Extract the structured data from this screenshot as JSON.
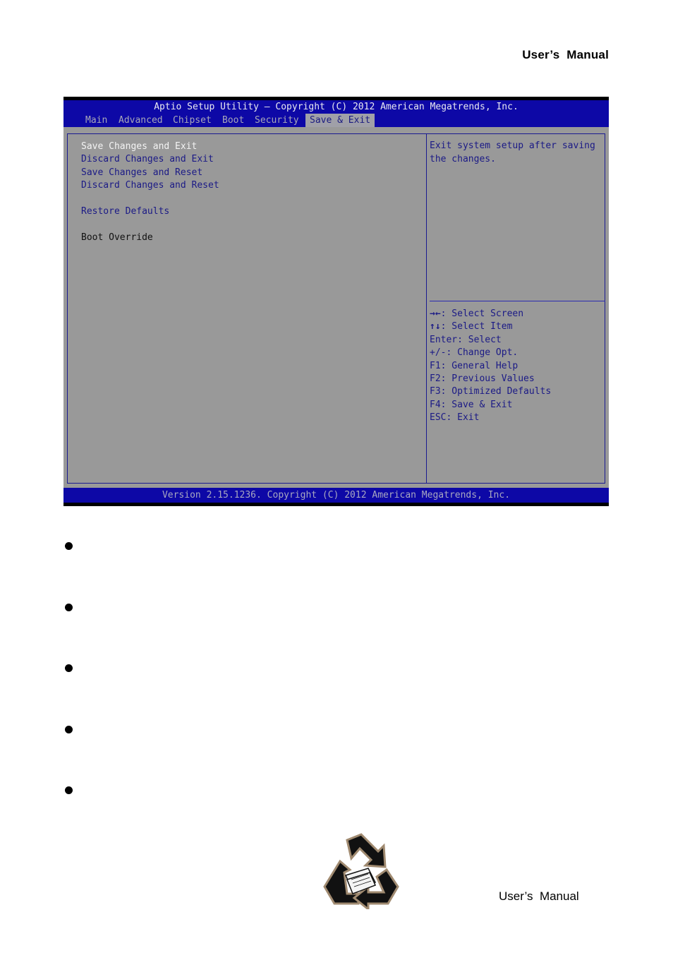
{
  "page": {
    "header_title": "User’s  Manual",
    "footer_title": "User’s  Manual",
    "bullet_count": 5,
    "logo_icon": "recycle-icon"
  },
  "bios": {
    "title": "Aptio Setup Utility – Copyright (C) 2012 American Megatrends, Inc.",
    "tabs": [
      {
        "label": "Main",
        "active": false
      },
      {
        "label": "Advanced",
        "active": false
      },
      {
        "label": "Chipset",
        "active": false
      },
      {
        "label": "Boot",
        "active": false
      },
      {
        "label": "Security",
        "active": false
      },
      {
        "label": "Save & Exit",
        "active": true
      }
    ],
    "menu": [
      {
        "label": "Save Changes and Exit",
        "state": "selected"
      },
      {
        "label": "Discard Changes and Exit",
        "state": "normal"
      },
      {
        "label": "Save Changes and Reset",
        "state": "normal"
      },
      {
        "label": "Discard Changes and Reset",
        "state": "normal"
      },
      {
        "label": "Restore Defaults",
        "state": "normal"
      },
      {
        "label": "Boot Override",
        "state": "static"
      }
    ],
    "help_text": "Exit system setup after saving\nthe changes.",
    "keys": [
      {
        "key": "→←",
        "action": ": Select Screen"
      },
      {
        "key": "↑↓",
        "action": ": Select Item"
      },
      {
        "key": "Enter",
        "action": ": Select"
      },
      {
        "key": "+/-",
        "action": ": Change Opt."
      },
      {
        "key": "F1",
        "action": ": General Help"
      },
      {
        "key": "F2",
        "action": ": Previous Values"
      },
      {
        "key": "F3",
        "action": ": Optimized Defaults"
      },
      {
        "key": "F4",
        "action": ": Save & Exit"
      },
      {
        "key": "ESC",
        "action": ": Exit"
      }
    ],
    "status": "Version 2.15.1236. Copyright (C) 2012 American Megatrends, Inc.",
    "colors": {
      "bar_blue": "#0d08a6",
      "panel_gray": "#999999",
      "text_blue": "#1b1a86",
      "selected_white": "#f4f4f4"
    }
  }
}
